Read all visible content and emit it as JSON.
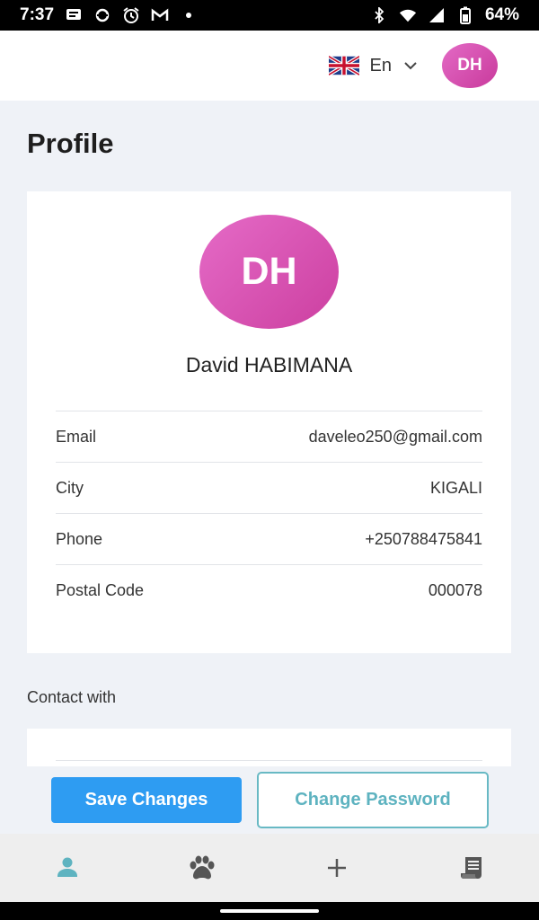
{
  "status_bar": {
    "time": "7:37",
    "battery": "64%",
    "left_icons": [
      "message-icon",
      "sync-icon",
      "alarm-icon",
      "gmail-icon",
      "dot-icon"
    ],
    "right_icons": [
      "bluetooth-icon",
      "wifi-icon",
      "signal-icon",
      "battery-icon"
    ]
  },
  "header": {
    "language": "En",
    "language_icon": "uk-flag-icon",
    "avatar_initials": "DH"
  },
  "page": {
    "title": "Profile"
  },
  "profile": {
    "initials": "DH",
    "name": "David HABIMANA",
    "fields": [
      {
        "label": "Email",
        "value": "daveleo250@gmail.com"
      },
      {
        "label": "City",
        "value": "KIGALI"
      },
      {
        "label": "Phone",
        "value": "+250788475841"
      },
      {
        "label": "Postal Code",
        "value": "000078"
      }
    ]
  },
  "contact": {
    "label": "Contact with"
  },
  "buttons": {
    "save": "Save Changes",
    "change_password": "Change Password"
  },
  "bottom_nav": [
    {
      "icon": "person-icon",
      "active": true,
      "color": "#5eb3c0"
    },
    {
      "icon": "paw-icon",
      "active": false
    },
    {
      "icon": "plus-icon",
      "active": false
    },
    {
      "icon": "receipt-icon",
      "active": false
    }
  ],
  "colors": {
    "accent_blue": "#2e9cf2",
    "teal": "#5eb3c0",
    "avatar_pink": "#d94fb0",
    "background": "#eff2f7"
  }
}
